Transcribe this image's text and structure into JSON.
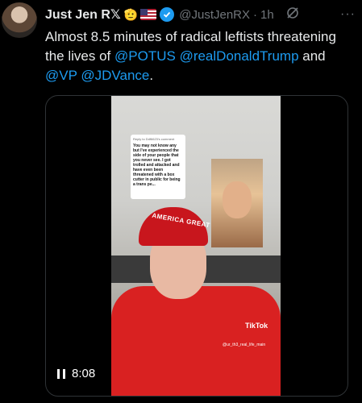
{
  "author": {
    "name": "Just Jen R",
    "x_mark": "𝕏",
    "emoji": "🫡",
    "handle": "@JustJenRX",
    "time": "1h"
  },
  "tweet": {
    "parts": [
      "Almost 8.5 minutes of radical leftists threatening the lives of ",
      "@POTUS",
      " ",
      "@realDonaldTrump",
      " and ",
      "@VP",
      " ",
      "@JDVance",
      "."
    ]
  },
  "media": {
    "duration": "8:08",
    "comment_header": "Reply to Ddf6623's comment",
    "comment_text": "You may not know any but I've experienced the side of your people that you never see. I got trolled and attacked and have even been threatened with a box cutter in public for being a trans pe...",
    "hat_text": "AMERICA GREAT",
    "tiktok_label": "TikTok",
    "tiktok_user": "@ur_th3_real_life_main"
  },
  "colors": {
    "background": "#000000",
    "text": "#e7e9ea",
    "muted": "#71767b",
    "link": "#1d9bf0",
    "verified": "#1d9bf0"
  }
}
